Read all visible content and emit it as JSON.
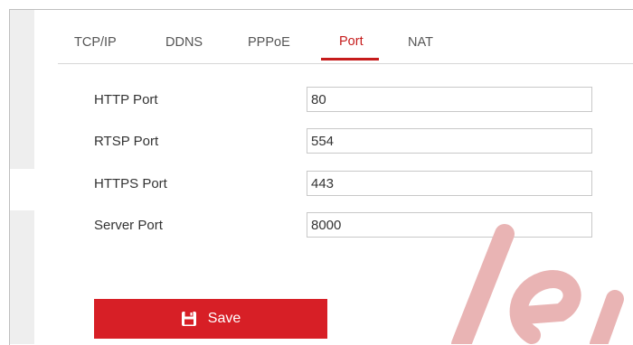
{
  "tabs": [
    {
      "label": "TCP/IP",
      "active": false
    },
    {
      "label": "DDNS",
      "active": false
    },
    {
      "label": "PPPoE",
      "active": false
    },
    {
      "label": "Port",
      "active": true
    },
    {
      "label": "NAT",
      "active": false
    }
  ],
  "ports": {
    "http": {
      "label": "HTTP Port",
      "value": "80"
    },
    "rtsp": {
      "label": "RTSP Port",
      "value": "554"
    },
    "https": {
      "label": "HTTPS Port",
      "value": "443"
    },
    "server": {
      "label": "Server Port",
      "value": "8000"
    }
  },
  "save_button": {
    "label": "Save",
    "icon": "floppy-disk-icon"
  },
  "colors": {
    "accent": "#d71f26",
    "active_tab": "#c61c1c",
    "label_text": "#333333",
    "input_border": "#c8c8c8",
    "watermark": "#e9b4b4"
  }
}
